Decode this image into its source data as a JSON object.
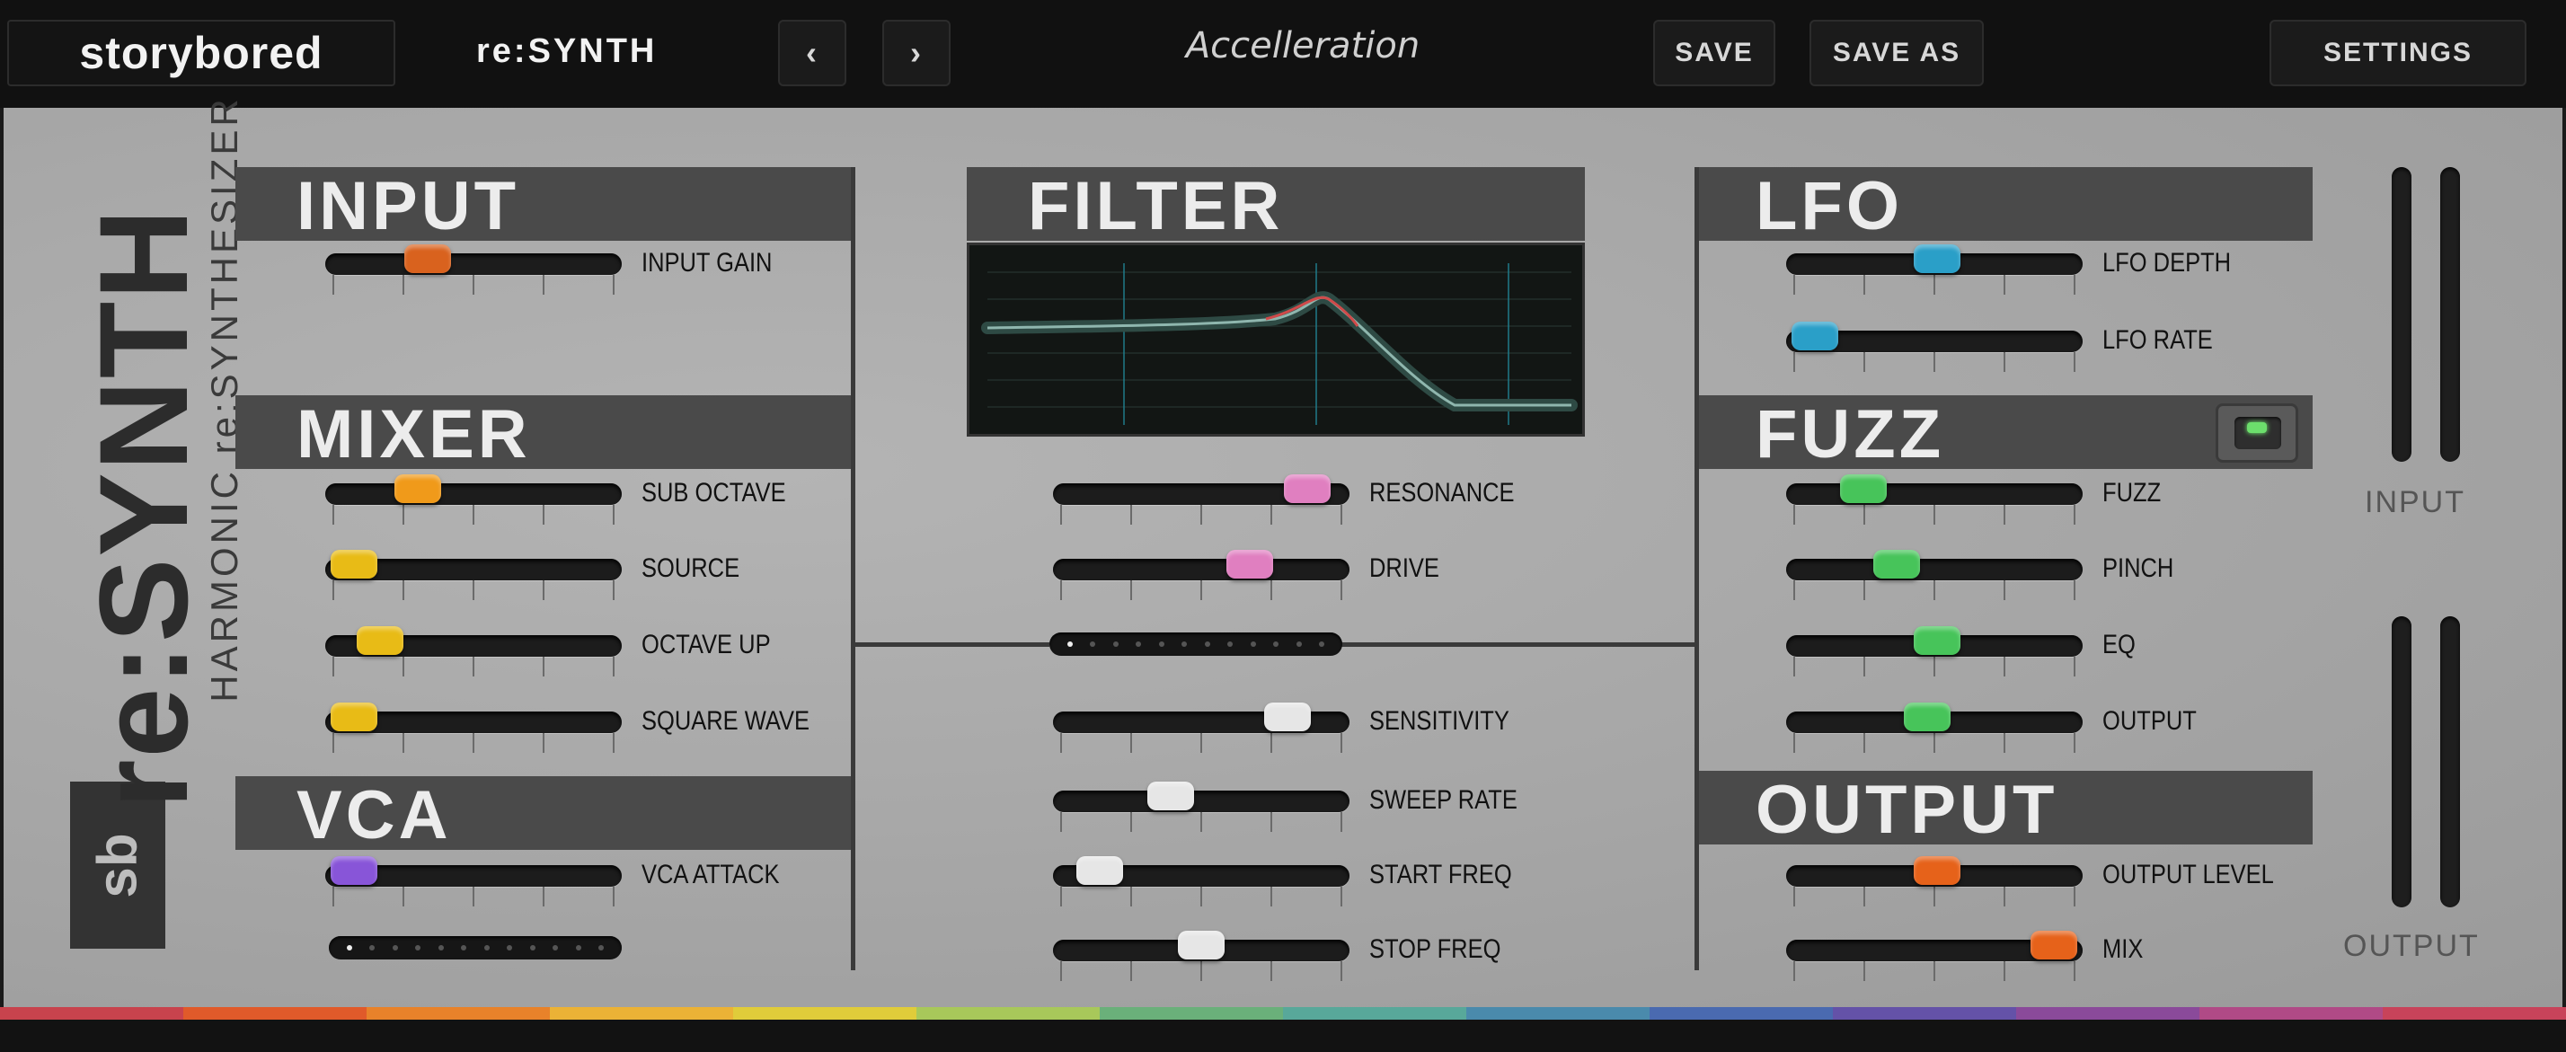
{
  "topbar": {
    "logo": "storybored",
    "plugin_name": "re:SYNTH",
    "prev_icon": "chevron-left-icon",
    "next_icon": "chevron-right-icon",
    "preset_name": "Accelleration",
    "save": "SAVE",
    "save_as": "SAVE AS",
    "settings": "SETTINGS"
  },
  "brand": {
    "logo": "sb",
    "title": "re:SYNTH",
    "subtitle": "HARMONIC re:SYNTHESIZER"
  },
  "sections": {
    "input": {
      "title": "INPUT",
      "sliders": [
        {
          "label": "INPUT GAIN",
          "value": 0.32,
          "color": "#d9621e"
        }
      ]
    },
    "mixer": {
      "title": "MIXER",
      "sliders": [
        {
          "label": "SUB OCTAVE",
          "value": 0.28,
          "color": "#f09a1a"
        },
        {
          "label": "SOURCE",
          "value": 0.03,
          "color": "#e8bb16"
        },
        {
          "label": "OCTAVE UP",
          "value": 0.13,
          "color": "#e8bb16"
        },
        {
          "label": "SQUARE WAVE",
          "value": 0.03,
          "color": "#e8bb16"
        }
      ]
    },
    "vca": {
      "title": "VCA",
      "sliders": [
        {
          "label": "VCA ATTACK",
          "value": 0.03,
          "color": "#8855d8"
        }
      ],
      "steps_active": 0
    },
    "filter": {
      "title": "FILTER",
      "sliders": [
        {
          "label": "RESONANCE",
          "value": 0.92,
          "color": "#e07fc0"
        },
        {
          "label": "DRIVE",
          "value": 0.69,
          "color": "#e07fc0"
        }
      ],
      "steps_active": 0,
      "envelope_sliders": [
        {
          "label": "SENSITIVITY",
          "value": 0.84,
          "color": "#e6e6e6"
        },
        {
          "label": "SWEEP RATE",
          "value": 0.38,
          "color": "#e6e6e6"
        },
        {
          "label": "START FREQ",
          "value": 0.1,
          "color": "#e6e6e6"
        },
        {
          "label": "STOP FREQ",
          "value": 0.5,
          "color": "#e6e6e6"
        }
      ]
    },
    "lfo": {
      "title": "LFO",
      "sliders": [
        {
          "label": "LFO DEPTH",
          "value": 0.51,
          "color": "#2a9fc8"
        },
        {
          "label": "LFO RATE",
          "value": 0.03,
          "color": "#2a9fc8"
        }
      ]
    },
    "fuzz": {
      "title": "FUZZ",
      "enabled": true,
      "sliders": [
        {
          "label": "FUZZ",
          "value": 0.22,
          "color": "#47c45a"
        },
        {
          "label": "PINCH",
          "value": 0.35,
          "color": "#47c45a"
        },
        {
          "label": "EQ",
          "value": 0.51,
          "color": "#47c45a"
        },
        {
          "label": "OUTPUT",
          "value": 0.47,
          "color": "#47c45a"
        }
      ]
    },
    "output": {
      "title": "OUTPUT",
      "sliders": [
        {
          "label": "OUTPUT LEVEL",
          "value": 0.51,
          "color": "#e6621a"
        },
        {
          "label": "MIX",
          "value": 0.97,
          "color": "#e6621a"
        }
      ]
    }
  },
  "meters": {
    "input_label": "INPUT",
    "output_label": "OUTPUT"
  },
  "stripe_colors": [
    "#c8434d",
    "#e05a2a",
    "#e8822a",
    "#ebb236",
    "#e0cc3a",
    "#a8c85a",
    "#6ab07a",
    "#58a89a",
    "#4a8aac",
    "#4a6ab0",
    "#6452a8",
    "#8a4a9a",
    "#b04a86",
    "#c8435a"
  ]
}
